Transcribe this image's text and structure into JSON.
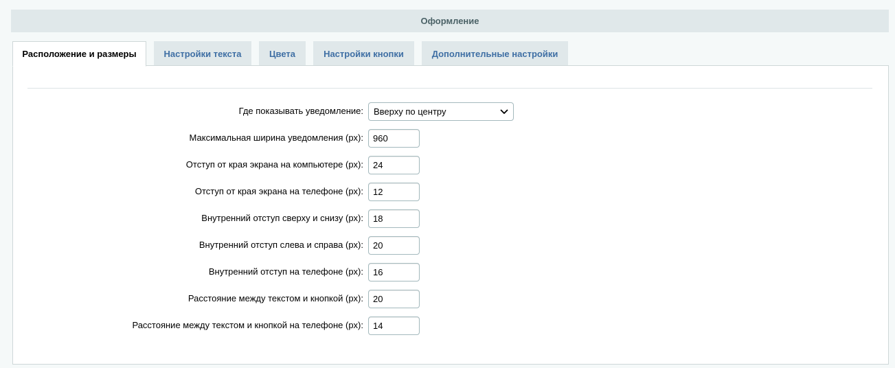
{
  "header": {
    "title": "Оформление"
  },
  "tabs": [
    {
      "label": "Расположение и размеры",
      "active": true
    },
    {
      "label": "Настройки текста",
      "active": false
    },
    {
      "label": "Цвета",
      "active": false
    },
    {
      "label": "Настройки кнопки",
      "active": false
    },
    {
      "label": "Дополнительные настройки",
      "active": false
    }
  ],
  "form": {
    "position": {
      "label": "Где показывать уведомление:",
      "value": "Вверху по центру"
    },
    "fields": [
      {
        "label": "Максимальная ширина уведомления (px):",
        "value": "960"
      },
      {
        "label": "Отступ от края экрана на компьютере (px):",
        "value": "24"
      },
      {
        "label": "Отступ от края экрана на телефоне (px):",
        "value": "12"
      },
      {
        "label": "Внутренний отступ сверху и снизу (px):",
        "value": "18"
      },
      {
        "label": "Внутренний отступ слева и справа (px):",
        "value": "20"
      },
      {
        "label": "Внутренний отступ на телефоне (px):",
        "value": "16"
      },
      {
        "label": "Расстояние между текстом и кнопкой (px):",
        "value": "20"
      },
      {
        "label": "Расстояние между текстом и кнопкой на телефоне (px):",
        "value": "14"
      }
    ]
  },
  "icons": {
    "select_arrow": "chevron-down-icon"
  }
}
